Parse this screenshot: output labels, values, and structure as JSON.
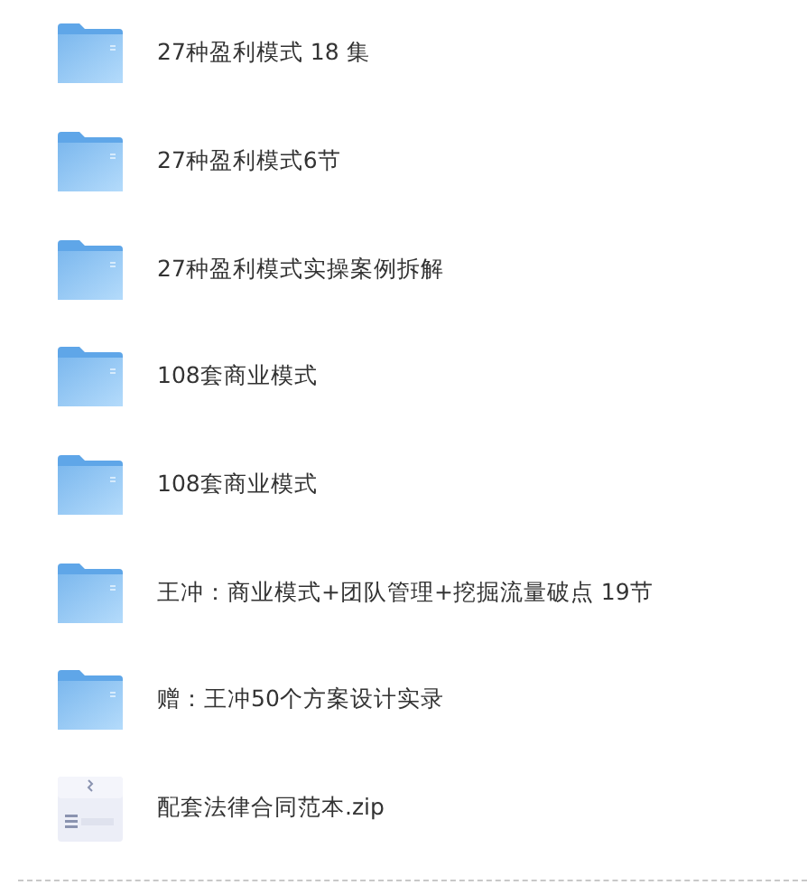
{
  "files": [
    {
      "kind": "folder",
      "name": "27种盈利模式 18 集"
    },
    {
      "kind": "folder",
      "name": "27种盈利模式6节"
    },
    {
      "kind": "folder",
      "name": "27种盈利模式实操案例拆解"
    },
    {
      "kind": "folder",
      "name": "108套商业模式"
    },
    {
      "kind": "folder",
      "name": "108套商业模式"
    },
    {
      "kind": "folder",
      "name": "王冲：商业模式+团队管理+挖掘流量破点 19节"
    },
    {
      "kind": "folder",
      "name": "赠：王冲50个方案设计实录"
    },
    {
      "kind": "zip",
      "name": "配套法律合同范本.zip"
    }
  ]
}
